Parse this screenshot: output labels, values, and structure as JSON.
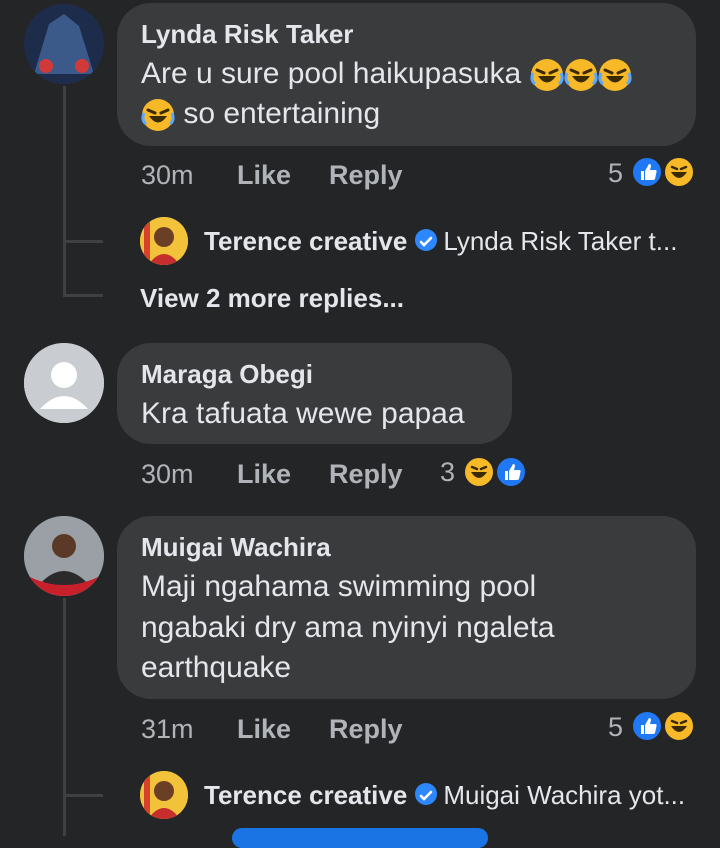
{
  "comments": [
    {
      "author": "Lynda Risk Taker",
      "text_line1": "Are u sure pool haikupasuka",
      "text_line2": "so entertaining",
      "time": "30m",
      "like_label": "Like",
      "reply_label": "Reply",
      "reaction_count": "5",
      "reply_preview": {
        "author": "Terence creative",
        "text": "Lynda Risk Taker  t..."
      },
      "view_more": "View 2 more replies..."
    },
    {
      "author": "Maraga Obegi",
      "text_line1": "Kra tafuata wewe papaa",
      "time": "30m",
      "like_label": "Like",
      "reply_label": "Reply",
      "reaction_count": "3"
    },
    {
      "author": "Muigai Wachira",
      "text_line1": "Maji ngahama swimming pool",
      "text_line2": "ngabaki dry ama nyinyi ngaleta",
      "text_line3": "earthquake",
      "time": "31m",
      "like_label": "Like",
      "reply_label": "Reply",
      "reaction_count": "5",
      "reply_preview": {
        "author": "Terence creative",
        "text": "Muigai Wachira  yot..."
      }
    }
  ],
  "colors": {
    "background": "#242526",
    "bubble": "#3a3b3c",
    "like_blue": "#2078f4",
    "haha_yellow": "#f7b928"
  }
}
